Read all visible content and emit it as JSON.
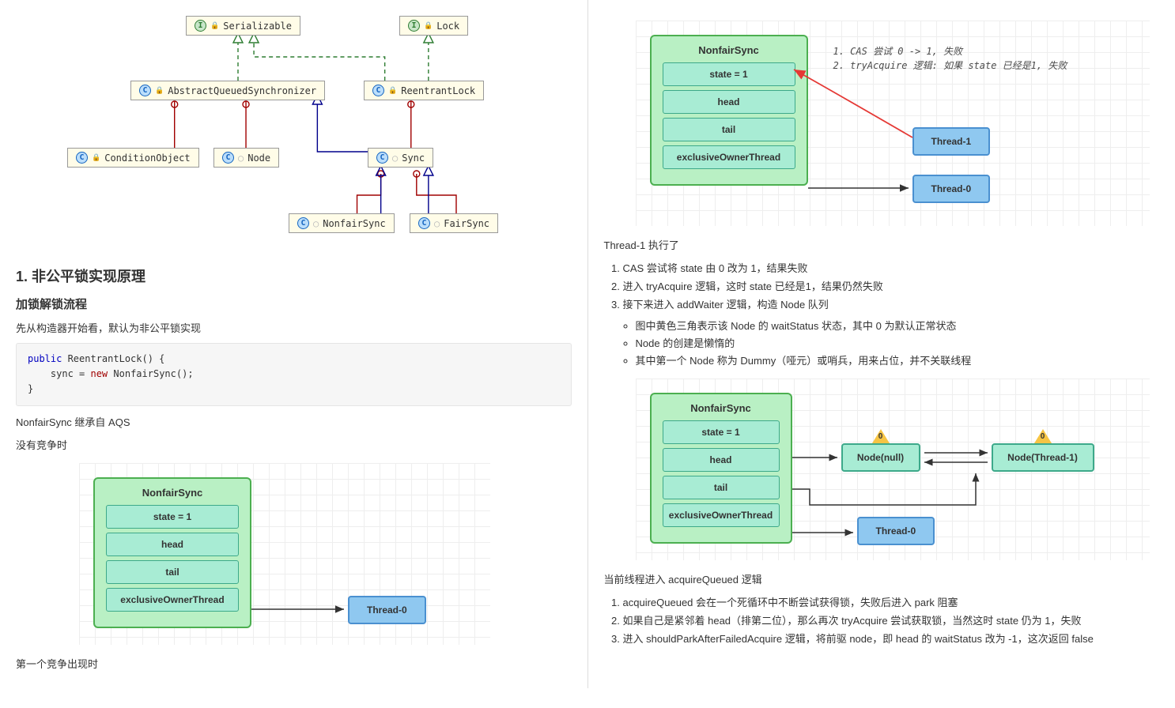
{
  "uml": {
    "serializable": "Serializable",
    "lock": "Lock",
    "aqs": "AbstractQueuedSynchronizer",
    "reentrantlock": "ReentrantLock",
    "conditionobject": "ConditionObject",
    "node": "Node",
    "sync": "Sync",
    "nonfairsync": "NonfairSync",
    "fairsync": "FairSync"
  },
  "left": {
    "heading1": "1. 非公平锁实现原理",
    "heading2": "加锁解锁流程",
    "p1": "先从构造器开始看，默认为非公平锁实现",
    "code_public": "public",
    "code_ctor": " ReentrantLock() {",
    "code_indent": "    sync = ",
    "code_new": "new",
    "code_rest": " NonfairSync();",
    "code_close": "}",
    "p2": "NonfairSync 继承自 AQS",
    "p3": "没有竞争时",
    "p4": "第一个竞争出现时"
  },
  "sync": {
    "title": "NonfairSync",
    "state": "state = 1",
    "head": "head",
    "tail": "tail",
    "eot": "exclusiveOwnerThread",
    "thread0": "Thread-0",
    "thread1": "Thread-1",
    "nodenull": "Node(null)",
    "nodethread1": "Node(Thread-1)"
  },
  "right": {
    "anno1": "1. CAS 尝试 0 -> 1, 失败",
    "anno2": "2. tryAcquire 逻辑: 如果 state 已经是1, 失败",
    "p_exec": "Thread-1 执行了",
    "ol1_1": "CAS 尝试将 state 由 0 改为 1，结果失败",
    "ol1_2": "进入 tryAcquire 逻辑，这时 state 已经是1，结果仍然失败",
    "ol1_3": "接下来进入 addWaiter 逻辑，构造 Node 队列",
    "ul_1": "图中黄色三角表示该 Node 的 waitStatus 状态，其中 0 为默认正常状态",
    "ul_2": "Node 的创建是懒惰的",
    "ul_3": "其中第一个 Node 称为 Dummy（哑元）或哨兵，用来占位，并不关联线程",
    "p_acq": "当前线程进入 acquireQueued 逻辑",
    "ol2_1": "acquireQueued 会在一个死循环中不断尝试获得锁，失败后进入 park 阻塞",
    "ol2_2": "如果自己是紧邻着 head（排第二位），那么再次 tryAcquire 尝试获取锁，当然这时 state 仍为 1，失败",
    "ol2_3": "进入 shouldParkAfterFailedAcquire 逻辑，将前驱 node，即 head 的 waitStatus 改为 -1，这次返回 false"
  },
  "tri_label": "0"
}
